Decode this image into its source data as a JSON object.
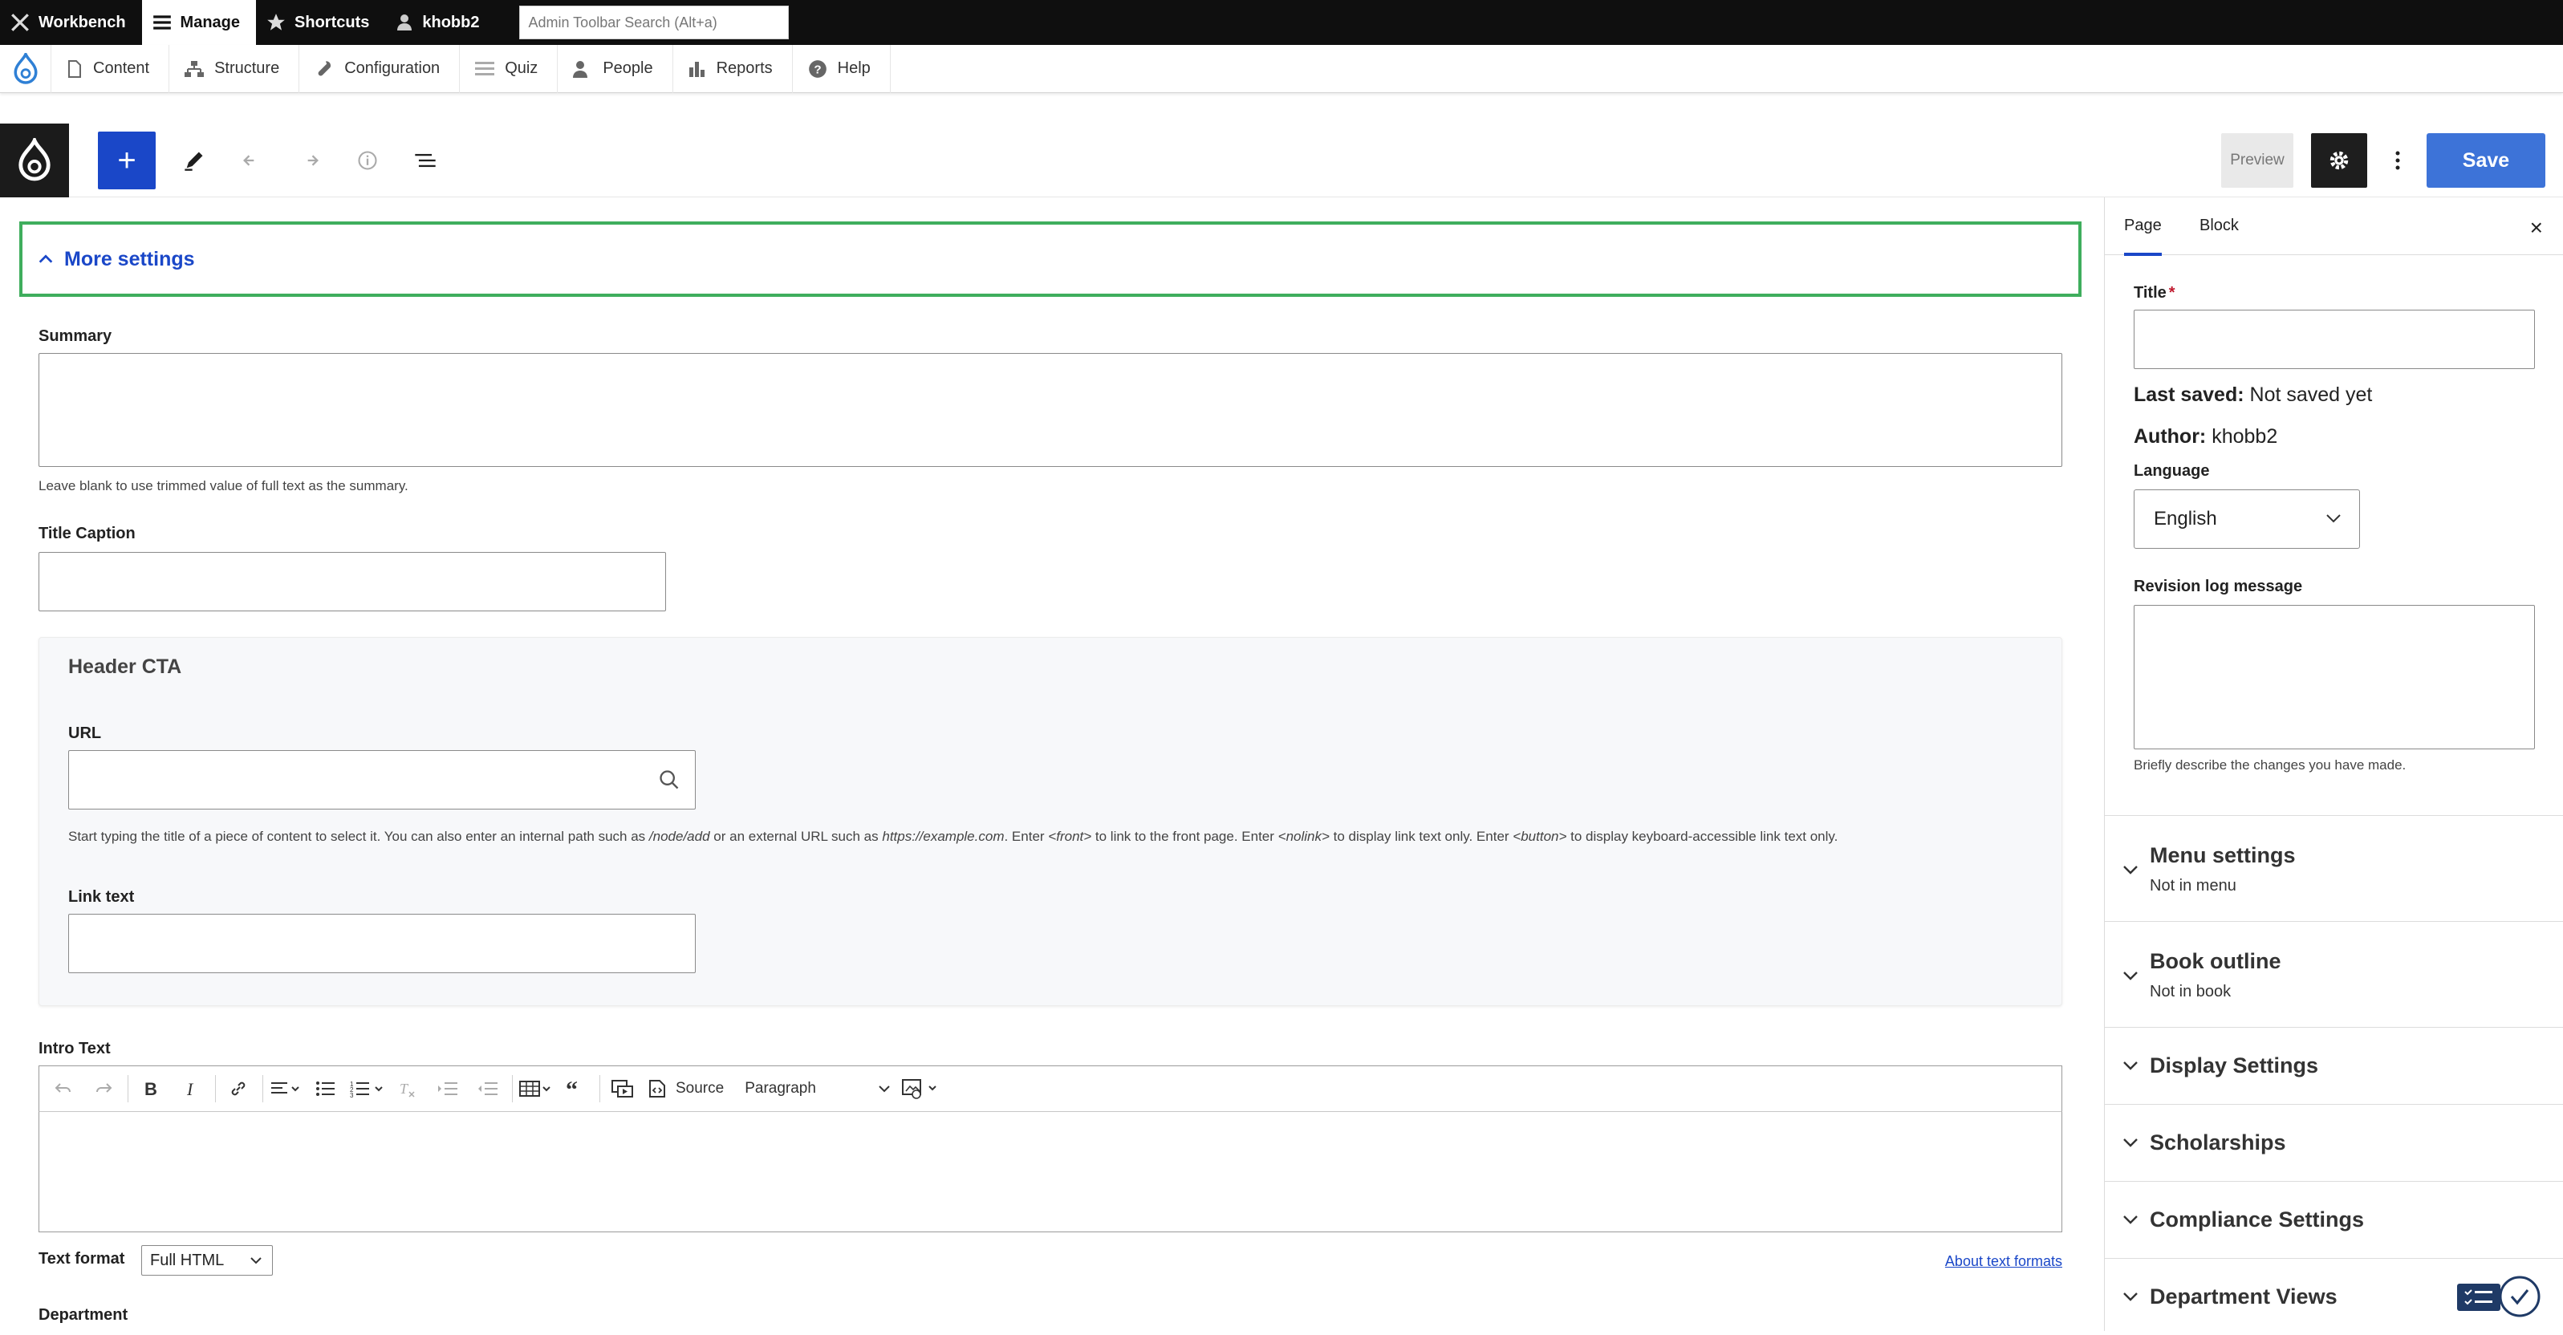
{
  "admin_toolbar": {
    "workbench": "Workbench",
    "manage": "Manage",
    "shortcuts": "Shortcuts",
    "user": "khobb2",
    "search_placeholder": "Admin Toolbar Search (Alt+a)"
  },
  "nav": {
    "items": [
      "Content",
      "Structure",
      "Configuration",
      "Quiz",
      "People",
      "Reports",
      "Help"
    ]
  },
  "editor_toolbar": {
    "add": "+",
    "preview": "Preview",
    "save": "Save"
  },
  "main": {
    "more_settings": "More settings",
    "summary_label": "Summary",
    "summary_hint": "Leave blank to use trimmed value of full text as the summary.",
    "title_caption_label": "Title Caption",
    "header_cta": {
      "title": "Header CTA",
      "url_label": "URL",
      "url_hint_1": "Start typing the title of a piece of content to select it. You can also enter an internal path such as ",
      "url_hint_path": "/node/add",
      "url_hint_2": " or an external URL such as ",
      "url_hint_example": "https://example.com",
      "url_hint_3": ". Enter ",
      "url_hint_front": "<front>",
      "url_hint_4": " to link to the front page. Enter ",
      "url_hint_nolink": "<nolink>",
      "url_hint_5": " to display link text only. Enter ",
      "url_hint_button": "<button>",
      "url_hint_6": " to display keyboard-accessible link text only.",
      "link_text_label": "Link text"
    },
    "intro_text_label": "Intro Text",
    "ck_source": "Source",
    "ck_paragraph": "Paragraph",
    "text_format_label": "Text format",
    "text_format_value": "Full HTML",
    "about_text_formats": "About text formats",
    "department_label": "Department"
  },
  "sidebar": {
    "tab_page": "Page",
    "tab_block": "Block",
    "close": "×",
    "title_label": "Title",
    "required_mark": "*",
    "last_saved_label": "Last saved:",
    "last_saved_value": "Not saved yet",
    "author_label": "Author:",
    "author_value": "khobb2",
    "language_label": "Language",
    "language_value": "English",
    "revision_label": "Revision log message",
    "revision_hint": "Briefly describe the changes you have made.",
    "sections": [
      {
        "title": "Menu settings",
        "summary": "Not in menu"
      },
      {
        "title": "Book outline",
        "summary": "Not in book"
      },
      {
        "title": "Display Settings",
        "summary": ""
      },
      {
        "title": "Scholarships",
        "summary": ""
      },
      {
        "title": "Compliance Settings",
        "summary": ""
      },
      {
        "title": "Department Views",
        "summary": ""
      }
    ]
  },
  "colors": {
    "accent_blue": "#1a47c8",
    "save_blue": "#3d73d8",
    "focus_green": "#3fae5d"
  }
}
